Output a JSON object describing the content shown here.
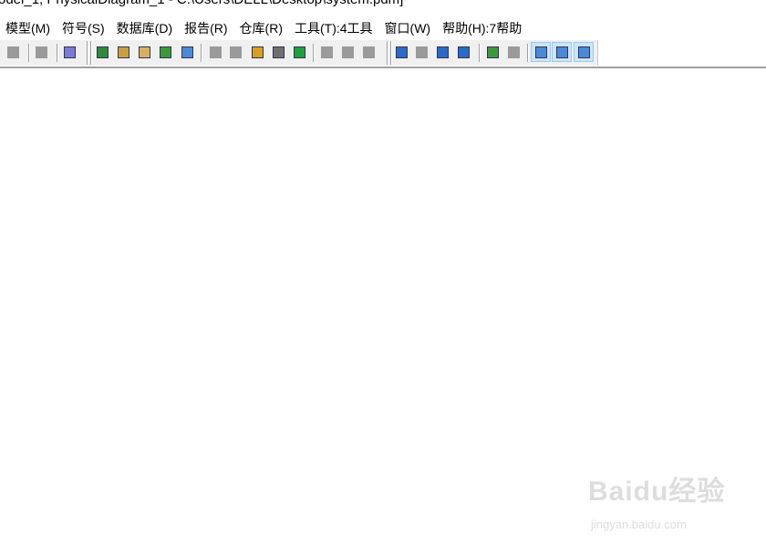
{
  "window": {
    "title": "odel_1, PhysicalDiagram_1 - C:\\Users\\DELL\\Desktop\\system.pdm]"
  },
  "menu": [
    "模型(M)",
    "符号(S)",
    "数据库(D)",
    "报告(R)",
    "仓库(R)",
    "工具(T):4工具",
    "窗口(W)",
    "帮助(H):7帮助"
  ],
  "toolbar": [
    {
      "icon": "redo-icon",
      "color": "#9a9a9a",
      "enabled": false
    },
    {
      "icon": "sep"
    },
    {
      "icon": "properties-icon",
      "color": "#9a9a9a",
      "enabled": false
    },
    {
      "icon": "sep"
    },
    {
      "icon": "help-icon",
      "color": "#7b7bd6",
      "enabled": true
    },
    {
      "icon": "grip"
    },
    {
      "icon": "new-model-icon",
      "color": "#2e8b3a",
      "enabled": true
    },
    {
      "icon": "paste-shortcut-icon",
      "color": "#c9a040",
      "enabled": true
    },
    {
      "icon": "find-objects-icon",
      "color": "#d9b060",
      "enabled": true
    },
    {
      "icon": "refresh-icon",
      "color": "#3a9a3a",
      "enabled": true
    },
    {
      "icon": "check-model-icon",
      "color": "#4a8ad6",
      "enabled": true
    },
    {
      "icon": "sep"
    },
    {
      "icon": "fill-icon",
      "color": "#9a9a9a",
      "enabled": false
    },
    {
      "icon": "line-style-icon",
      "color": "#9a9a9a",
      "enabled": false
    },
    {
      "icon": "brush-icon",
      "color": "#d8a020",
      "enabled": true
    },
    {
      "icon": "paint-bucket-icon",
      "color": "#707070",
      "enabled": true
    },
    {
      "icon": "font-icon",
      "color": "#20a040",
      "enabled": true
    },
    {
      "icon": "sep"
    },
    {
      "icon": "object-icon",
      "color": "#9a9a9a",
      "enabled": false
    },
    {
      "icon": "back-arrow-icon",
      "color": "#9a9a9a",
      "enabled": false
    },
    {
      "icon": "forward-arrow-icon",
      "color": "#9a9a9a",
      "enabled": false
    },
    {
      "icon": "grip"
    },
    {
      "icon": "diagram-icon",
      "color": "#2a6ac8",
      "enabled": true
    },
    {
      "icon": "frame-icon",
      "color": "#9a9a9a",
      "enabled": false
    },
    {
      "icon": "page-icon",
      "color": "#2a6ac8",
      "enabled": true
    },
    {
      "icon": "two-pages-icon",
      "color": "#2a6ac8",
      "enabled": true
    },
    {
      "icon": "sep"
    },
    {
      "icon": "generate-icon",
      "color": "#3a9a3a",
      "enabled": true
    },
    {
      "icon": "reverse-icon",
      "color": "#9a9a9a",
      "enabled": false
    },
    {
      "icon": "sep"
    },
    {
      "icon": "browser-icon",
      "color": "#4a8ad6",
      "enabled": true,
      "active": true
    },
    {
      "icon": "output-icon",
      "color": "#4a8ad6",
      "enabled": true,
      "active": true
    },
    {
      "icon": "result-list-icon",
      "color": "#4a8ad6",
      "enabled": true,
      "active": true
    }
  ],
  "watermark": {
    "logo": "Baidu经验",
    "url": "jingyan.baidu.com"
  }
}
